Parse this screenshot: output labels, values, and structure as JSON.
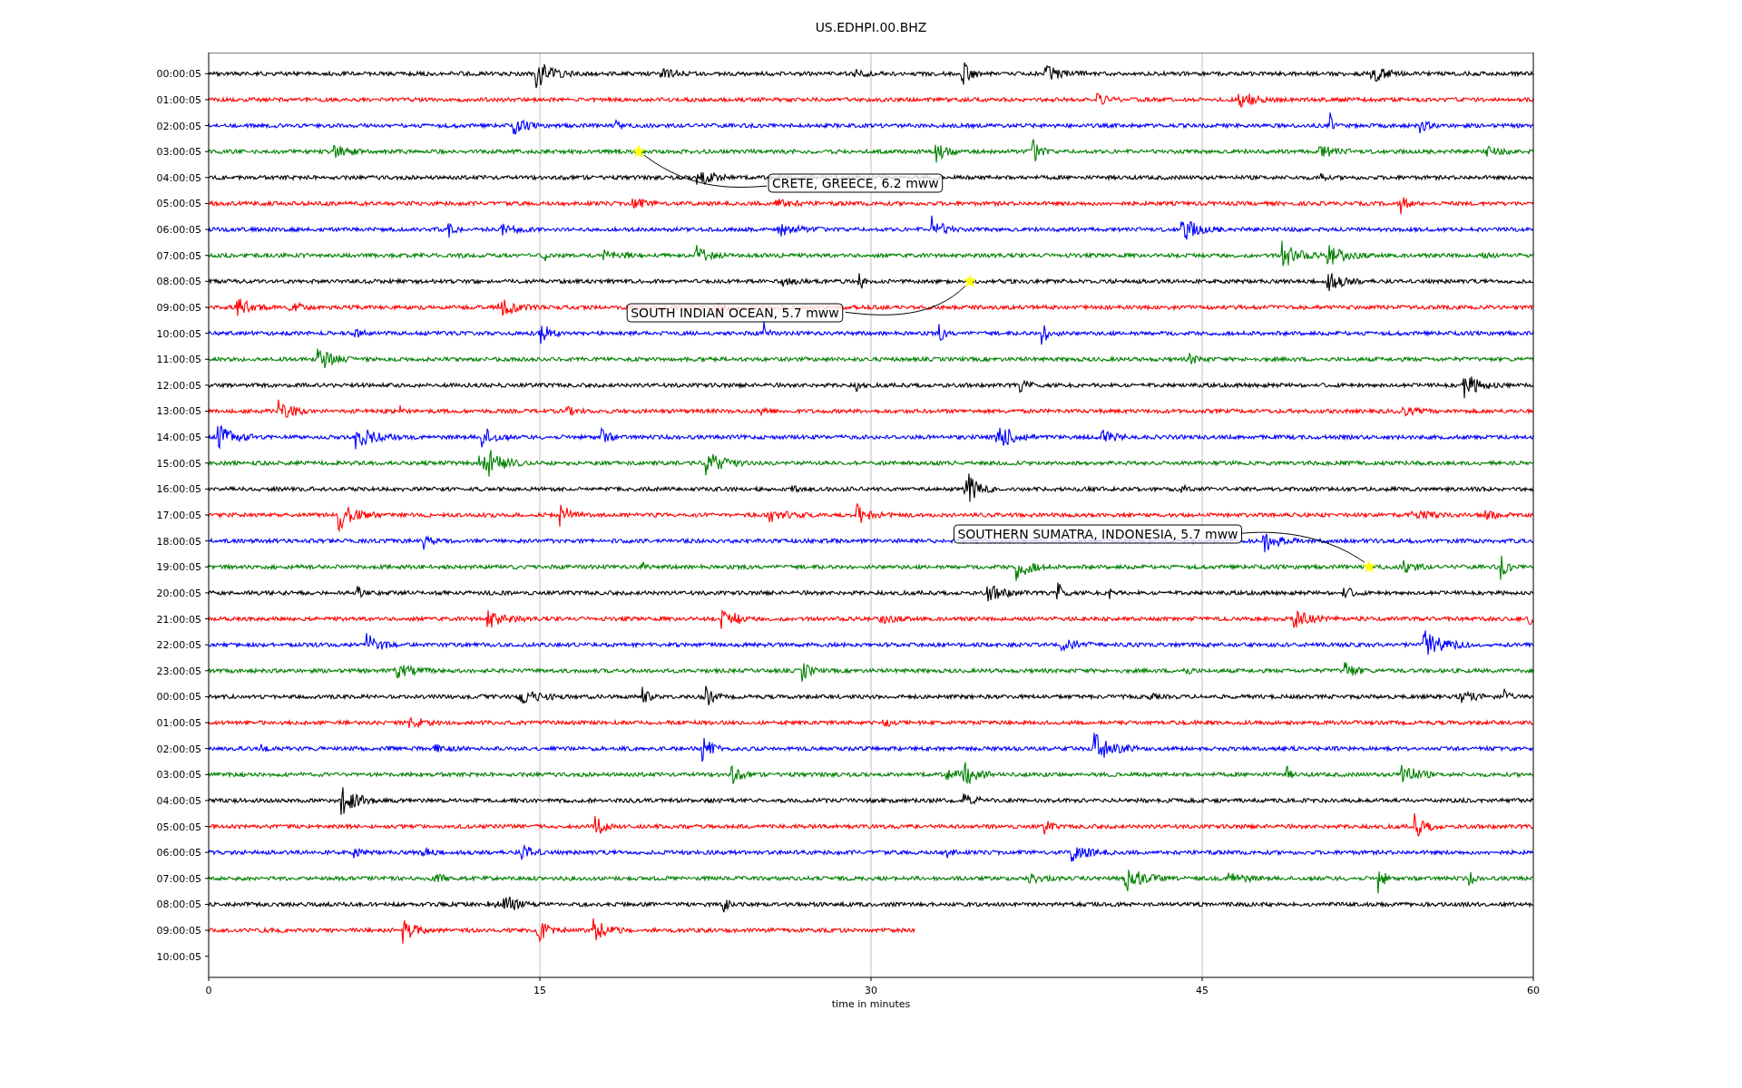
{
  "title": "US.EDHPI.00.BHZ",
  "plot": {
    "xlabel": "time in minutes",
    "xticks": [
      "0",
      "15",
      "30",
      "45",
      "60"
    ],
    "row_labels": [
      "00:00:05",
      "01:00:05",
      "02:00:05",
      "03:00:05",
      "04:00:05",
      "05:00:05",
      "06:00:05",
      "07:00:05",
      "08:00:05",
      "09:00:05",
      "10:00:05",
      "11:00:05",
      "12:00:05",
      "13:00:05",
      "14:00:05",
      "15:00:05",
      "16:00:05",
      "17:00:05",
      "18:00:05",
      "19:00:05",
      "20:00:05",
      "21:00:05",
      "22:00:05",
      "23:00:05",
      "00:00:05",
      "01:00:05",
      "02:00:05",
      "03:00:05",
      "04:00:05",
      "05:00:05",
      "06:00:05",
      "07:00:05",
      "08:00:05",
      "09:00:05",
      "10:00:05"
    ],
    "traces": [
      {
        "color": "#000000",
        "level": 1
      },
      {
        "color": "#ff0000",
        "level": 1
      },
      {
        "color": "#0000ff",
        "level": 1
      },
      {
        "color": "#008000",
        "level": 1,
        "event": {
          "label": "CRETE, GREECE, 6.2 mww"
        }
      },
      {
        "color": "#000000",
        "level": 1
      },
      {
        "color": "#ff0000",
        "level": 1
      },
      {
        "color": "#0000ff",
        "level": 1
      },
      {
        "color": "#008000",
        "level": 1
      },
      {
        "color": "#000000",
        "level": 1,
        "event": {
          "label": "SOUTH INDIAN OCEAN, 5.7 mww"
        }
      },
      {
        "color": "#ff0000",
        "level": 1
      },
      {
        "color": "#0000ff",
        "level": 1
      },
      {
        "color": "#008000",
        "level": 1
      },
      {
        "color": "#000000",
        "level": 1
      },
      {
        "color": "#ff0000",
        "level": 1
      },
      {
        "color": "#0000ff",
        "level": 1
      },
      {
        "color": "#008000",
        "level": 1
      },
      {
        "color": "#000000",
        "level": 1
      },
      {
        "color": "#ff0000",
        "level": 1
      },
      {
        "color": "#0000ff",
        "level": 1
      },
      {
        "color": "#008000",
        "level": 1,
        "event": {
          "label": "SOUTHERN SUMATRA, INDONESIA, 5.7 mww"
        }
      },
      {
        "color": "#000000",
        "level": 1
      },
      {
        "color": "#ff0000",
        "level": 1
      },
      {
        "color": "#0000ff",
        "level": 1
      },
      {
        "color": "#008000",
        "level": 1
      },
      {
        "color": "#000000",
        "level": 1
      },
      {
        "color": "#ff0000",
        "level": 1
      },
      {
        "color": "#0000ff",
        "level": 1
      },
      {
        "color": "#008000",
        "level": 1
      },
      {
        "color": "#000000",
        "level": 1
      },
      {
        "color": "#ff0000",
        "level": 1
      },
      {
        "color": "#0000ff",
        "level": 1
      },
      {
        "color": "#008000",
        "level": 1
      },
      {
        "color": "#000000",
        "level": 1
      },
      {
        "color": "#ff0000",
        "level": 0.533
      }
    ]
  }
}
